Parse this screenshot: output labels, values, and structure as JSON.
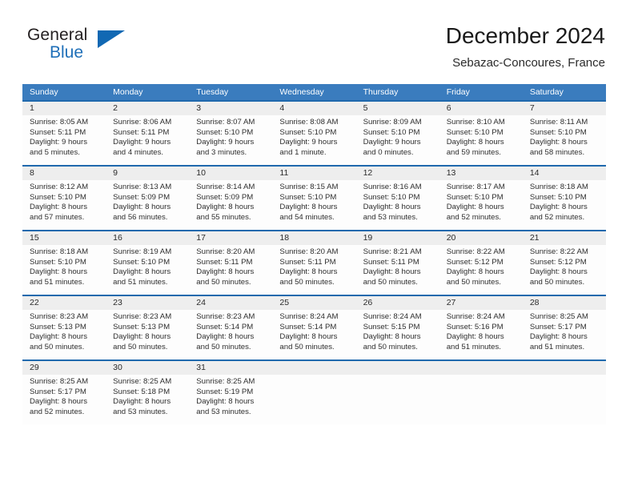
{
  "brand": {
    "general": "General",
    "blue": "Blue"
  },
  "header": {
    "title": "December 2024",
    "subtitle": "Sebazac-Concoures, France"
  },
  "colors": {
    "header_blue": "#3a7cbe",
    "rule_blue": "#1f69ad",
    "daynum_band": "#eeeeee",
    "brand_blue": "#1168b3",
    "text": "#2e2e2e"
  },
  "weekdays": [
    "Sunday",
    "Monday",
    "Tuesday",
    "Wednesday",
    "Thursday",
    "Friday",
    "Saturday"
  ],
  "weeks": [
    {
      "days": [
        {
          "num": "1",
          "sunrise": "Sunrise: 8:05 AM",
          "sunset": "Sunset: 5:11 PM",
          "daylight1": "Daylight: 9 hours",
          "daylight2": "and 5 minutes."
        },
        {
          "num": "2",
          "sunrise": "Sunrise: 8:06 AM",
          "sunset": "Sunset: 5:11 PM",
          "daylight1": "Daylight: 9 hours",
          "daylight2": "and 4 minutes."
        },
        {
          "num": "3",
          "sunrise": "Sunrise: 8:07 AM",
          "sunset": "Sunset: 5:10 PM",
          "daylight1": "Daylight: 9 hours",
          "daylight2": "and 3 minutes."
        },
        {
          "num": "4",
          "sunrise": "Sunrise: 8:08 AM",
          "sunset": "Sunset: 5:10 PM",
          "daylight1": "Daylight: 9 hours",
          "daylight2": "and 1 minute."
        },
        {
          "num": "5",
          "sunrise": "Sunrise: 8:09 AM",
          "sunset": "Sunset: 5:10 PM",
          "daylight1": "Daylight: 9 hours",
          "daylight2": "and 0 minutes."
        },
        {
          "num": "6",
          "sunrise": "Sunrise: 8:10 AM",
          "sunset": "Sunset: 5:10 PM",
          "daylight1": "Daylight: 8 hours",
          "daylight2": "and 59 minutes."
        },
        {
          "num": "7",
          "sunrise": "Sunrise: 8:11 AM",
          "sunset": "Sunset: 5:10 PM",
          "daylight1": "Daylight: 8 hours",
          "daylight2": "and 58 minutes."
        }
      ]
    },
    {
      "days": [
        {
          "num": "8",
          "sunrise": "Sunrise: 8:12 AM",
          "sunset": "Sunset: 5:10 PM",
          "daylight1": "Daylight: 8 hours",
          "daylight2": "and 57 minutes."
        },
        {
          "num": "9",
          "sunrise": "Sunrise: 8:13 AM",
          "sunset": "Sunset: 5:09 PM",
          "daylight1": "Daylight: 8 hours",
          "daylight2": "and 56 minutes."
        },
        {
          "num": "10",
          "sunrise": "Sunrise: 8:14 AM",
          "sunset": "Sunset: 5:09 PM",
          "daylight1": "Daylight: 8 hours",
          "daylight2": "and 55 minutes."
        },
        {
          "num": "11",
          "sunrise": "Sunrise: 8:15 AM",
          "sunset": "Sunset: 5:10 PM",
          "daylight1": "Daylight: 8 hours",
          "daylight2": "and 54 minutes."
        },
        {
          "num": "12",
          "sunrise": "Sunrise: 8:16 AM",
          "sunset": "Sunset: 5:10 PM",
          "daylight1": "Daylight: 8 hours",
          "daylight2": "and 53 minutes."
        },
        {
          "num": "13",
          "sunrise": "Sunrise: 8:17 AM",
          "sunset": "Sunset: 5:10 PM",
          "daylight1": "Daylight: 8 hours",
          "daylight2": "and 52 minutes."
        },
        {
          "num": "14",
          "sunrise": "Sunrise: 8:18 AM",
          "sunset": "Sunset: 5:10 PM",
          "daylight1": "Daylight: 8 hours",
          "daylight2": "and 52 minutes."
        }
      ]
    },
    {
      "days": [
        {
          "num": "15",
          "sunrise": "Sunrise: 8:18 AM",
          "sunset": "Sunset: 5:10 PM",
          "daylight1": "Daylight: 8 hours",
          "daylight2": "and 51 minutes."
        },
        {
          "num": "16",
          "sunrise": "Sunrise: 8:19 AM",
          "sunset": "Sunset: 5:10 PM",
          "daylight1": "Daylight: 8 hours",
          "daylight2": "and 51 minutes."
        },
        {
          "num": "17",
          "sunrise": "Sunrise: 8:20 AM",
          "sunset": "Sunset: 5:11 PM",
          "daylight1": "Daylight: 8 hours",
          "daylight2": "and 50 minutes."
        },
        {
          "num": "18",
          "sunrise": "Sunrise: 8:20 AM",
          "sunset": "Sunset: 5:11 PM",
          "daylight1": "Daylight: 8 hours",
          "daylight2": "and 50 minutes."
        },
        {
          "num": "19",
          "sunrise": "Sunrise: 8:21 AM",
          "sunset": "Sunset: 5:11 PM",
          "daylight1": "Daylight: 8 hours",
          "daylight2": "and 50 minutes."
        },
        {
          "num": "20",
          "sunrise": "Sunrise: 8:22 AM",
          "sunset": "Sunset: 5:12 PM",
          "daylight1": "Daylight: 8 hours",
          "daylight2": "and 50 minutes."
        },
        {
          "num": "21",
          "sunrise": "Sunrise: 8:22 AM",
          "sunset": "Sunset: 5:12 PM",
          "daylight1": "Daylight: 8 hours",
          "daylight2": "and 50 minutes."
        }
      ]
    },
    {
      "days": [
        {
          "num": "22",
          "sunrise": "Sunrise: 8:23 AM",
          "sunset": "Sunset: 5:13 PM",
          "daylight1": "Daylight: 8 hours",
          "daylight2": "and 50 minutes."
        },
        {
          "num": "23",
          "sunrise": "Sunrise: 8:23 AM",
          "sunset": "Sunset: 5:13 PM",
          "daylight1": "Daylight: 8 hours",
          "daylight2": "and 50 minutes."
        },
        {
          "num": "24",
          "sunrise": "Sunrise: 8:23 AM",
          "sunset": "Sunset: 5:14 PM",
          "daylight1": "Daylight: 8 hours",
          "daylight2": "and 50 minutes."
        },
        {
          "num": "25",
          "sunrise": "Sunrise: 8:24 AM",
          "sunset": "Sunset: 5:14 PM",
          "daylight1": "Daylight: 8 hours",
          "daylight2": "and 50 minutes."
        },
        {
          "num": "26",
          "sunrise": "Sunrise: 8:24 AM",
          "sunset": "Sunset: 5:15 PM",
          "daylight1": "Daylight: 8 hours",
          "daylight2": "and 50 minutes."
        },
        {
          "num": "27",
          "sunrise": "Sunrise: 8:24 AM",
          "sunset": "Sunset: 5:16 PM",
          "daylight1": "Daylight: 8 hours",
          "daylight2": "and 51 minutes."
        },
        {
          "num": "28",
          "sunrise": "Sunrise: 8:25 AM",
          "sunset": "Sunset: 5:17 PM",
          "daylight1": "Daylight: 8 hours",
          "daylight2": "and 51 minutes."
        }
      ]
    },
    {
      "days": [
        {
          "num": "29",
          "sunrise": "Sunrise: 8:25 AM",
          "sunset": "Sunset: 5:17 PM",
          "daylight1": "Daylight: 8 hours",
          "daylight2": "and 52 minutes."
        },
        {
          "num": "30",
          "sunrise": "Sunrise: 8:25 AM",
          "sunset": "Sunset: 5:18 PM",
          "daylight1": "Daylight: 8 hours",
          "daylight2": "and 53 minutes."
        },
        {
          "num": "31",
          "sunrise": "Sunrise: 8:25 AM",
          "sunset": "Sunset: 5:19 PM",
          "daylight1": "Daylight: 8 hours",
          "daylight2": "and 53 minutes."
        },
        {
          "num": "",
          "sunrise": "",
          "sunset": "",
          "daylight1": "",
          "daylight2": ""
        },
        {
          "num": "",
          "sunrise": "",
          "sunset": "",
          "daylight1": "",
          "daylight2": ""
        },
        {
          "num": "",
          "sunrise": "",
          "sunset": "",
          "daylight1": "",
          "daylight2": ""
        },
        {
          "num": "",
          "sunrise": "",
          "sunset": "",
          "daylight1": "",
          "daylight2": ""
        }
      ]
    }
  ]
}
